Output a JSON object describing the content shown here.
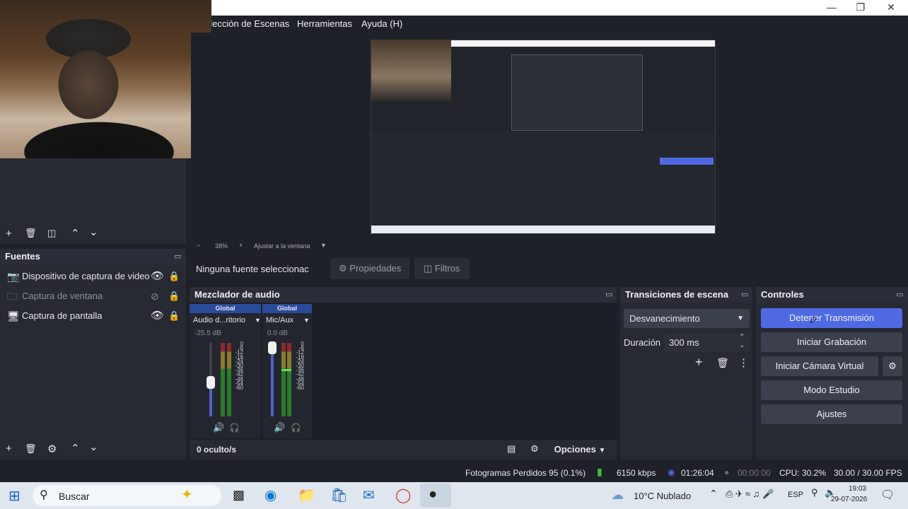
{
  "window": {
    "minimize_icon": "minimize-icon",
    "maximize_icon": "restore-icon",
    "close_icon": "close-icon"
  },
  "menu": {
    "items": [
      "olección de Escenas",
      "Herramientas",
      "Ayuda (H)"
    ]
  },
  "preview": {
    "zoom_minus": "−",
    "zoom_level": "38%",
    "zoom_plus": "+",
    "fit_label": "Ajustar a la ventana"
  },
  "sources_toolbar_selection": {
    "no_source": "Ninguna fuente seleccionac",
    "properties": "Propiedades",
    "filters": "Filtros"
  },
  "sources": {
    "title": "Fuentes",
    "items": [
      {
        "label": "Dispositivo de captura de video",
        "visible": true,
        "locked": true
      },
      {
        "label": "Captura de ventana",
        "visible": false,
        "locked": true
      },
      {
        "label": "Captura de pantalla",
        "visible": true,
        "locked": true
      }
    ]
  },
  "mixer": {
    "title": "Mezclador de audio",
    "channels": [
      {
        "tag": "Global",
        "name": "Audio d...ritorio",
        "db": "-25.5 dB",
        "volume": 0.46
      },
      {
        "tag": "Global",
        "name": "Mic/Aux",
        "db": "0.0 dB",
        "volume": 0.93
      }
    ],
    "scale": [
      "0",
      "-6",
      "-12",
      "-18",
      "-24",
      "-30",
      "-36",
      "-42",
      "-48",
      "-54",
      "-60"
    ],
    "hidden_label": "0 oculto/s",
    "options_label": "Opciones"
  },
  "transitions": {
    "title": "Transiciones de escena",
    "selected": "Desvanecimiento",
    "duration_label": "Duración",
    "duration_value": "300 ms"
  },
  "controls": {
    "title": "Controles",
    "stop_stream": "Detener Transmisión",
    "start_recording": "Iniciar Grabación",
    "start_virtual_cam": "Iniciar Cámara Virtual",
    "studio_mode": "Modo Estudio",
    "settings": "Ajustes"
  },
  "status": {
    "dropped_frames": "Fotogramas Perdidos 95 (0.1%)",
    "bitrate": "6150 kbps",
    "stream_time": "01:26:04",
    "rec_time": "00:00:00",
    "cpu": "CPU: 30.2%",
    "fps": "30.00 / 30.00 FPS"
  },
  "taskbar": {
    "search_placeholder": "Buscar",
    "weather": "10°C  Nublado",
    "language": "ESP",
    "time": "19:03",
    "date": "29-07-2026"
  },
  "colors": {
    "accent_blue": "#4f6ae3",
    "panel": "#272a33",
    "button": "#3c404d"
  }
}
